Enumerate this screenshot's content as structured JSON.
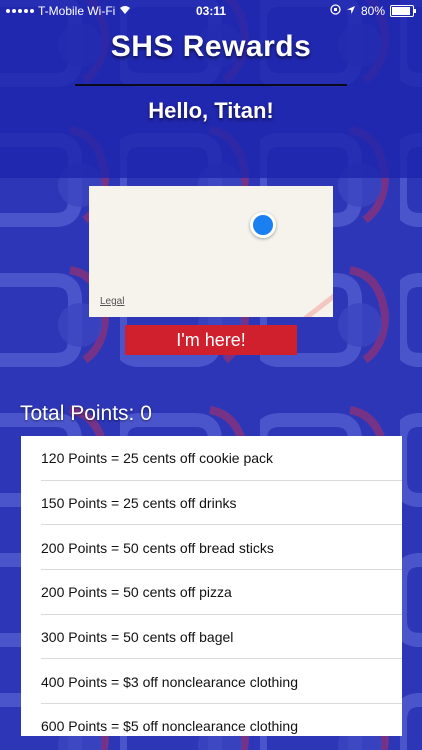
{
  "status_bar": {
    "carrier": "T-Mobile Wi-Fi",
    "time": "03:11",
    "battery_percent": "80%",
    "battery_level": 0.8
  },
  "header": {
    "title": "SHS Rewards",
    "greeting": "Hello, Titan!"
  },
  "map": {
    "legal_label": "Legal"
  },
  "check_in_button": {
    "label": "I'm here!"
  },
  "points": {
    "total_label": "Total Points: 0"
  },
  "rewards": [
    "120 Points = 25 cents off cookie pack",
    "150 Points = 25 cents off drinks",
    "200 Points = 50 cents off bread sticks",
    "200 Points = 50 cents off pizza",
    "300 Points = 50 cents off bagel",
    "400 Points = $3 off nonclearance clothing",
    "600 Points = $5 off nonclearance clothing"
  ],
  "colors": {
    "background_blue": "#2a33b0",
    "button_red": "#d0202e",
    "location_blue": "#1a7ff0"
  }
}
